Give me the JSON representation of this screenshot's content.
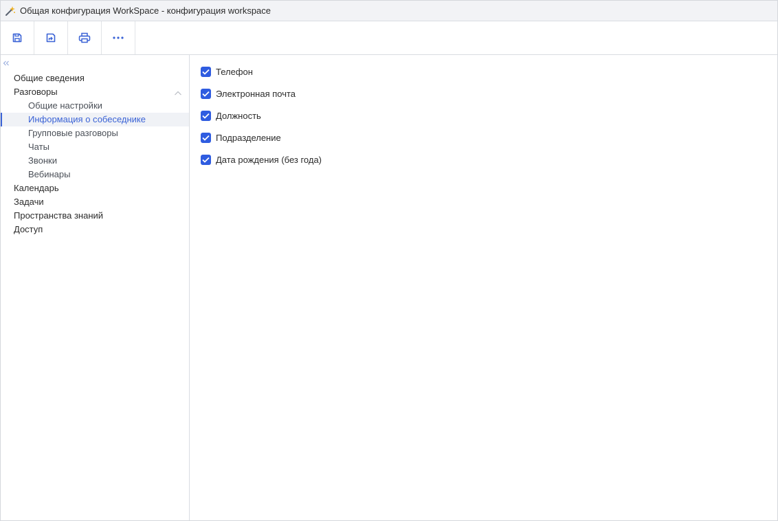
{
  "window": {
    "title": "Общая конфигурация WorkSpace - конфигурация workspace",
    "icon": "magic-wand-icon"
  },
  "toolbar": {
    "buttons": [
      {
        "name": "save",
        "icon": "floppy-disk-icon"
      },
      {
        "name": "save-and-close",
        "icon": "floppy-disk-arrow-icon"
      },
      {
        "name": "print",
        "icon": "printer-icon"
      },
      {
        "name": "more",
        "icon": "ellipsis-icon"
      }
    ],
    "accent": "#3b63d6"
  },
  "sidebar": {
    "items": [
      {
        "label": "Общие сведения",
        "level": 1
      },
      {
        "label": "Разговоры",
        "level": 1,
        "expanded": true
      },
      {
        "label": "Общие настройки",
        "level": 2
      },
      {
        "label": "Информация о собеседнике",
        "level": 2,
        "active": true
      },
      {
        "label": "Групповые разговоры",
        "level": 2
      },
      {
        "label": "Чаты",
        "level": 2
      },
      {
        "label": "Звонки",
        "level": 2
      },
      {
        "label": "Вебинары",
        "level": 2
      },
      {
        "label": "Календарь",
        "level": 1
      },
      {
        "label": "Задачи",
        "level": 1
      },
      {
        "label": "Пространства знаний",
        "level": 1
      },
      {
        "label": "Доступ",
        "level": 1
      }
    ]
  },
  "main": {
    "checkboxes": [
      {
        "label": "Телефон",
        "checked": true
      },
      {
        "label": "Электронная почта",
        "checked": true
      },
      {
        "label": "Должность",
        "checked": true
      },
      {
        "label": "Подразделение",
        "checked": true
      },
      {
        "label": "Дата рождения (без года)",
        "checked": true
      }
    ]
  },
  "colors": {
    "accent": "#3b63d6",
    "checkbox": "#2f5ce0",
    "active_bg": "#f0f2f6"
  }
}
